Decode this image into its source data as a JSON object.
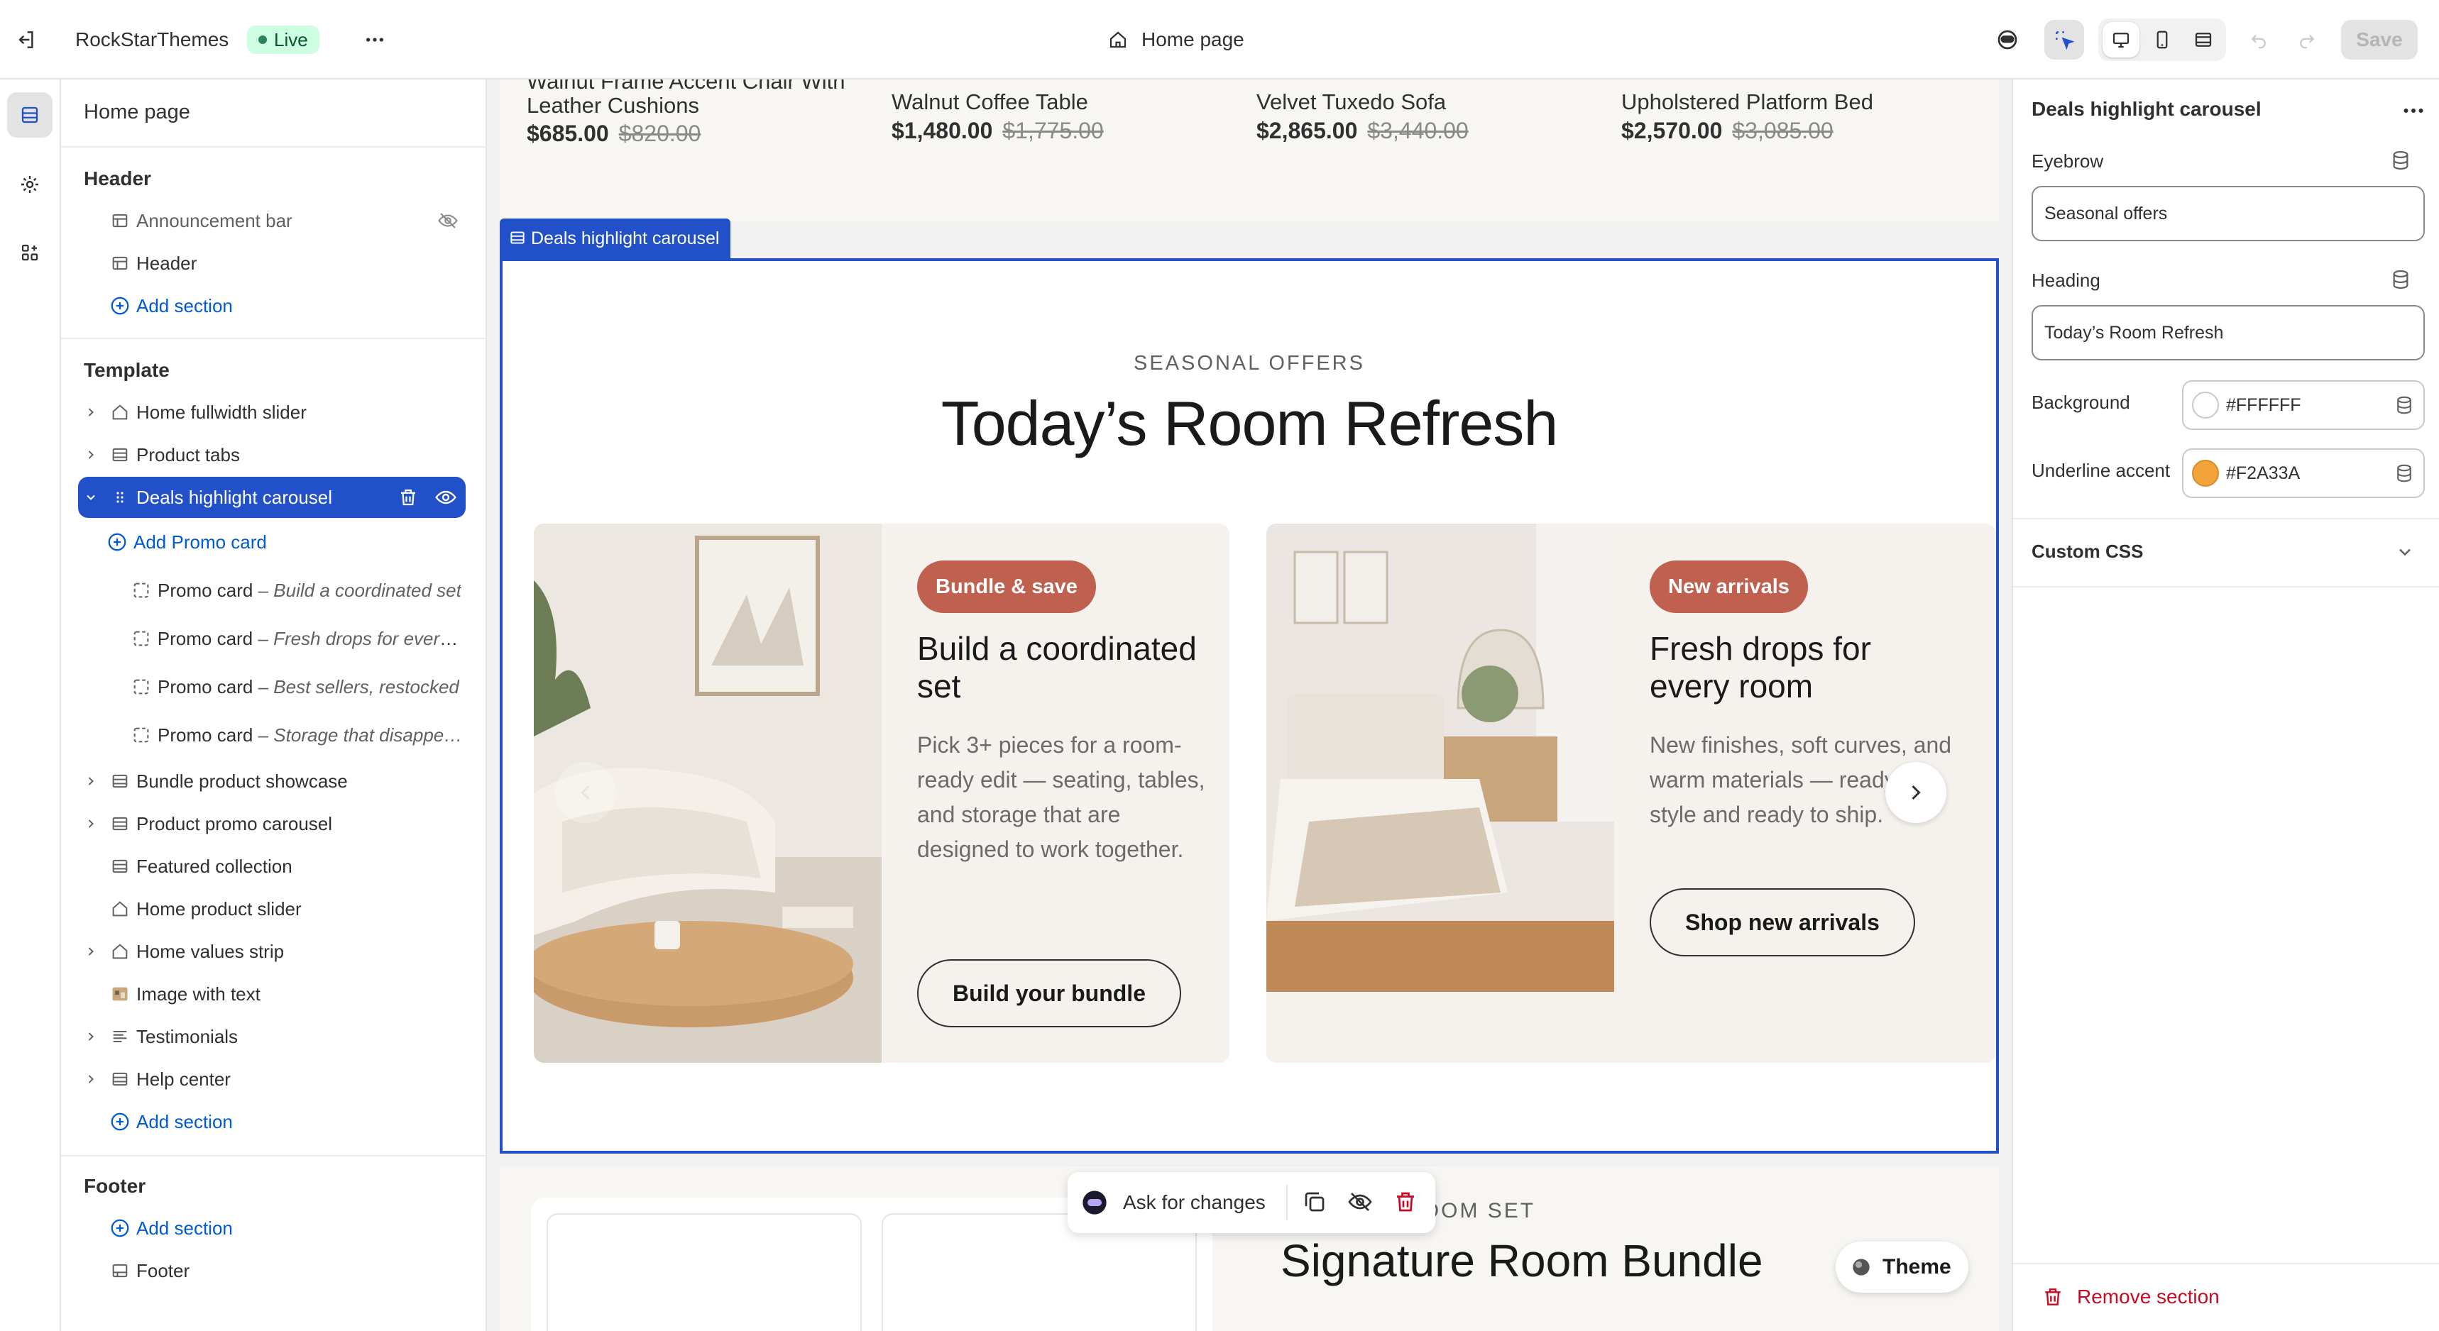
{
  "topbar": {
    "store_name": "RockStarThemes",
    "status_badge": "Live",
    "page_name": "Home page",
    "save_label": "Save"
  },
  "left_panel": {
    "title": "Home page",
    "header_group": {
      "title": "Header",
      "items": [
        "Announcement bar",
        "Header"
      ],
      "add_label": "Add section"
    },
    "template_group": {
      "title": "Template",
      "items": [
        "Home fullwidth slider",
        "Product tabs",
        "Deals highlight carousel"
      ],
      "add_promo_label": "Add Promo card",
      "promo_cards": [
        {
          "label": "Promo card",
          "desc": "– Build a coordinated set"
        },
        {
          "label": "Promo card",
          "desc": "– Fresh drops for every…"
        },
        {
          "label": "Promo card",
          "desc": "– Best sellers, restocked"
        },
        {
          "label": "Promo card",
          "desc": "– Storage that disappe…"
        }
      ],
      "items_after": [
        "Bundle product showcase",
        "Product promo carousel",
        "Featured collection",
        "Home product slider",
        "Home values strip",
        "Image with text",
        "Testimonials",
        "Help center"
      ],
      "add_label": "Add section"
    },
    "footer_group": {
      "title": "Footer",
      "add_label": "Add section",
      "items": [
        "Footer"
      ]
    }
  },
  "canvas": {
    "products": [
      {
        "name": "Walnut Frame Accent Chair With Leather Cushions",
        "price": "$685.00",
        "compare": "$820.00"
      },
      {
        "name": "Walnut Coffee Table",
        "price": "$1,480.00",
        "compare": "$1,775.00"
      },
      {
        "name": "Velvet Tuxedo Sofa",
        "price": "$2,865.00",
        "compare": "$3,440.00"
      },
      {
        "name": "Upholstered Platform Bed",
        "price": "$2,570.00",
        "compare": "$3,085.00"
      }
    ],
    "section_tag": "Deals highlight carousel",
    "eyebrow": "SEASONAL OFFERS",
    "heading": "Today’s Room Refresh",
    "cards": [
      {
        "badge": "Bundle & save",
        "title": "Build a coordinated set",
        "body": "Pick 3+ pieces for a room-ready edit — seating, tables, and storage that are designed to work together.",
        "button": "Build your bundle"
      },
      {
        "badge": "New arrivals",
        "title": "Fresh drops for every room",
        "body": "New finishes, soft curves, and warm materials — ready to style and ready to ship.",
        "button": "Shop new arrivals"
      }
    ],
    "ask_label": "Ask for changes",
    "next_eyebrow": "CURATED ROOM SET",
    "next_heading": "Signature Room Bundle",
    "theme_label": "Theme"
  },
  "right_panel": {
    "title": "Deals highlight carousel",
    "eyebrow_label": "Eyebrow",
    "eyebrow_value": "Seasonal offers",
    "heading_label": "Heading",
    "heading_value": "Today’s Room Refresh",
    "background_label": "Background",
    "background_value": "#FFFFFF",
    "accent_label": "Underline accent",
    "accent_value": "#F2A33A",
    "custom_css_label": "Custom CSS",
    "remove_label": "Remove section"
  },
  "colors": {
    "selection": "#2150c8",
    "badge": "#c0614f",
    "accent_swatch": "#F2A33A",
    "live_badge_bg": "#cdfee1"
  }
}
